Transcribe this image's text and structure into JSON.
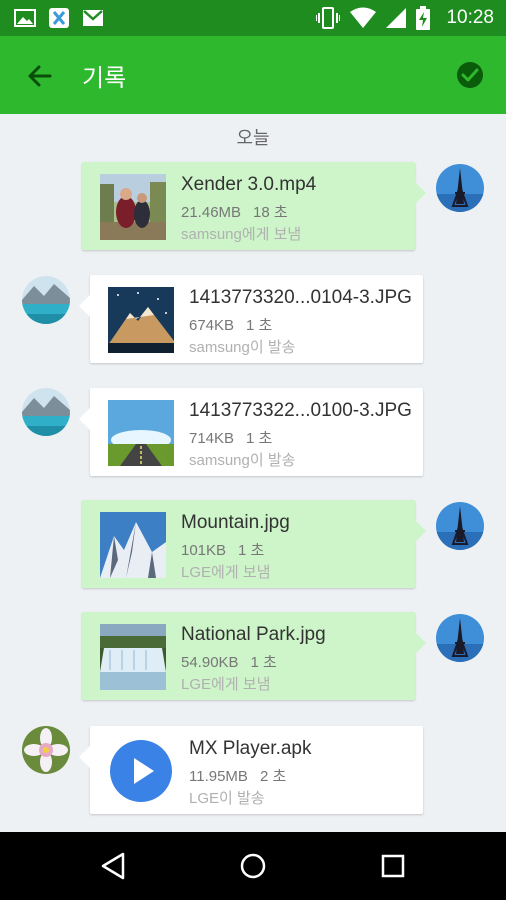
{
  "status_bar": {
    "time": "10:28",
    "left_icons": [
      "image-icon",
      "xender-icon",
      "gmail-icon"
    ],
    "right_icons": [
      "vibrate-icon",
      "wifi-icon",
      "signal-icon",
      "battery-charging-icon"
    ]
  },
  "app_bar": {
    "title": "기록",
    "back_icon": "arrow-back-icon",
    "action_icon": "check-circle-icon",
    "color": "#2eb82e"
  },
  "date_header": "오늘",
  "transfers": [
    {
      "direction": "sent",
      "name": "Xender 3.0.mp4",
      "size": "21.46MB",
      "duration": "18 초",
      "status": "samsung에게 보냄",
      "thumb": "video-thumbnail"
    },
    {
      "direction": "received",
      "name": "1413773320...0104-3.JPG",
      "size": "674KB",
      "duration": "1 초",
      "status": "samsung이 발송",
      "thumb": "mountain-starry-thumbnail"
    },
    {
      "direction": "received",
      "name": "1413773322...0100-3.JPG",
      "size": "714KB",
      "duration": "1 초",
      "status": "samsung이 발송",
      "thumb": "road-sky-thumbnail"
    },
    {
      "direction": "sent",
      "name": "Mountain.jpg",
      "size": "101KB",
      "duration": "1 초",
      "status": "LGE에게 보냄",
      "thumb": "snow-mountain-thumbnail"
    },
    {
      "direction": "sent",
      "name": "National Park.jpg",
      "size": "54.90KB",
      "duration": "1 초",
      "status": "LGE에게 보냄",
      "thumb": "waterfall-thumbnail"
    },
    {
      "direction": "received",
      "name": "MX Player.apk",
      "size": "11.95MB",
      "duration": "2 초",
      "status": "LGE이 발송",
      "thumb": "play-app-icon"
    }
  ],
  "colors": {
    "sent_card": "#cdf5c9",
    "received_card": "#ffffff",
    "status_bar": "#1e8c1e"
  },
  "nav_bar": {
    "back": "nav-back-icon",
    "home": "nav-home-icon",
    "recents": "nav-recents-icon"
  }
}
